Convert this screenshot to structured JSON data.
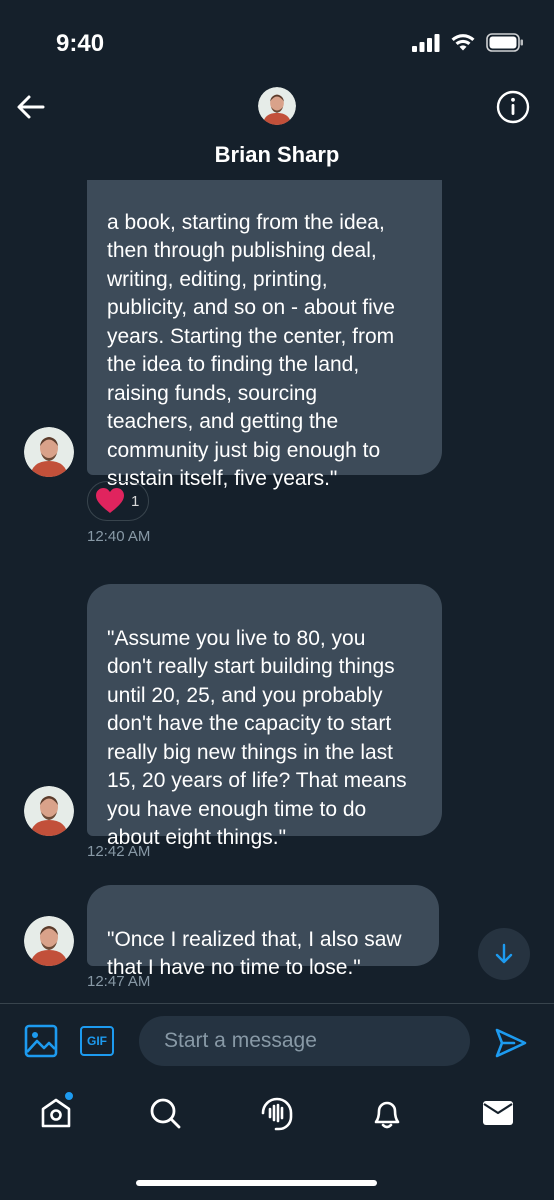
{
  "status_bar": {
    "time": "9:40",
    "icons": [
      "signal-icon",
      "wifi-icon",
      "battery-icon"
    ]
  },
  "header": {
    "contact_name": "Brian Sharp",
    "back_icon": "arrow-left-icon",
    "info_icon": "info-icon"
  },
  "messages": [
    {
      "text": "a book, starting from the idea,\nthen through publishing deal,\nwriting, editing, printing,\npublicity, and so on - about five\nyears. Starting the center, from\nthe idea to finding the land,\nraising funds, sourcing\nteachers, and getting the\ncommunity just big enough to\nsustain itself, five years.\"",
      "reaction": {
        "icon": "heart-icon",
        "count": "1"
      },
      "timestamp": "12:40 AM"
    },
    {
      "text": "\"Assume you live to 80, you\ndon't really start building things\nuntil 20, 25, and you probably\ndon't have the capacity to start\nreally big new things in the last\n15, 20 years of life? That means\nyou have enough time to do\nabout eight things.\"",
      "timestamp": "12:42 AM"
    },
    {
      "text": "\"Once I realized that, I also saw\nthat I have no time to lose.\"",
      "timestamp": "12:47 AM"
    }
  ],
  "composer": {
    "placeholder": "Start a message",
    "gif_label": "GIF",
    "media_icon": "image-icon",
    "send_icon": "send-icon"
  },
  "tab_bar": {
    "items": [
      "home-icon",
      "search-icon",
      "spaces-icon",
      "notifications-icon",
      "messages-icon"
    ]
  },
  "colors": {
    "background": "#15202b",
    "bubble": "#3d4b59",
    "accent": "#1d9bf0",
    "muted_text": "#8899a6",
    "heart": "#e0245e"
  }
}
